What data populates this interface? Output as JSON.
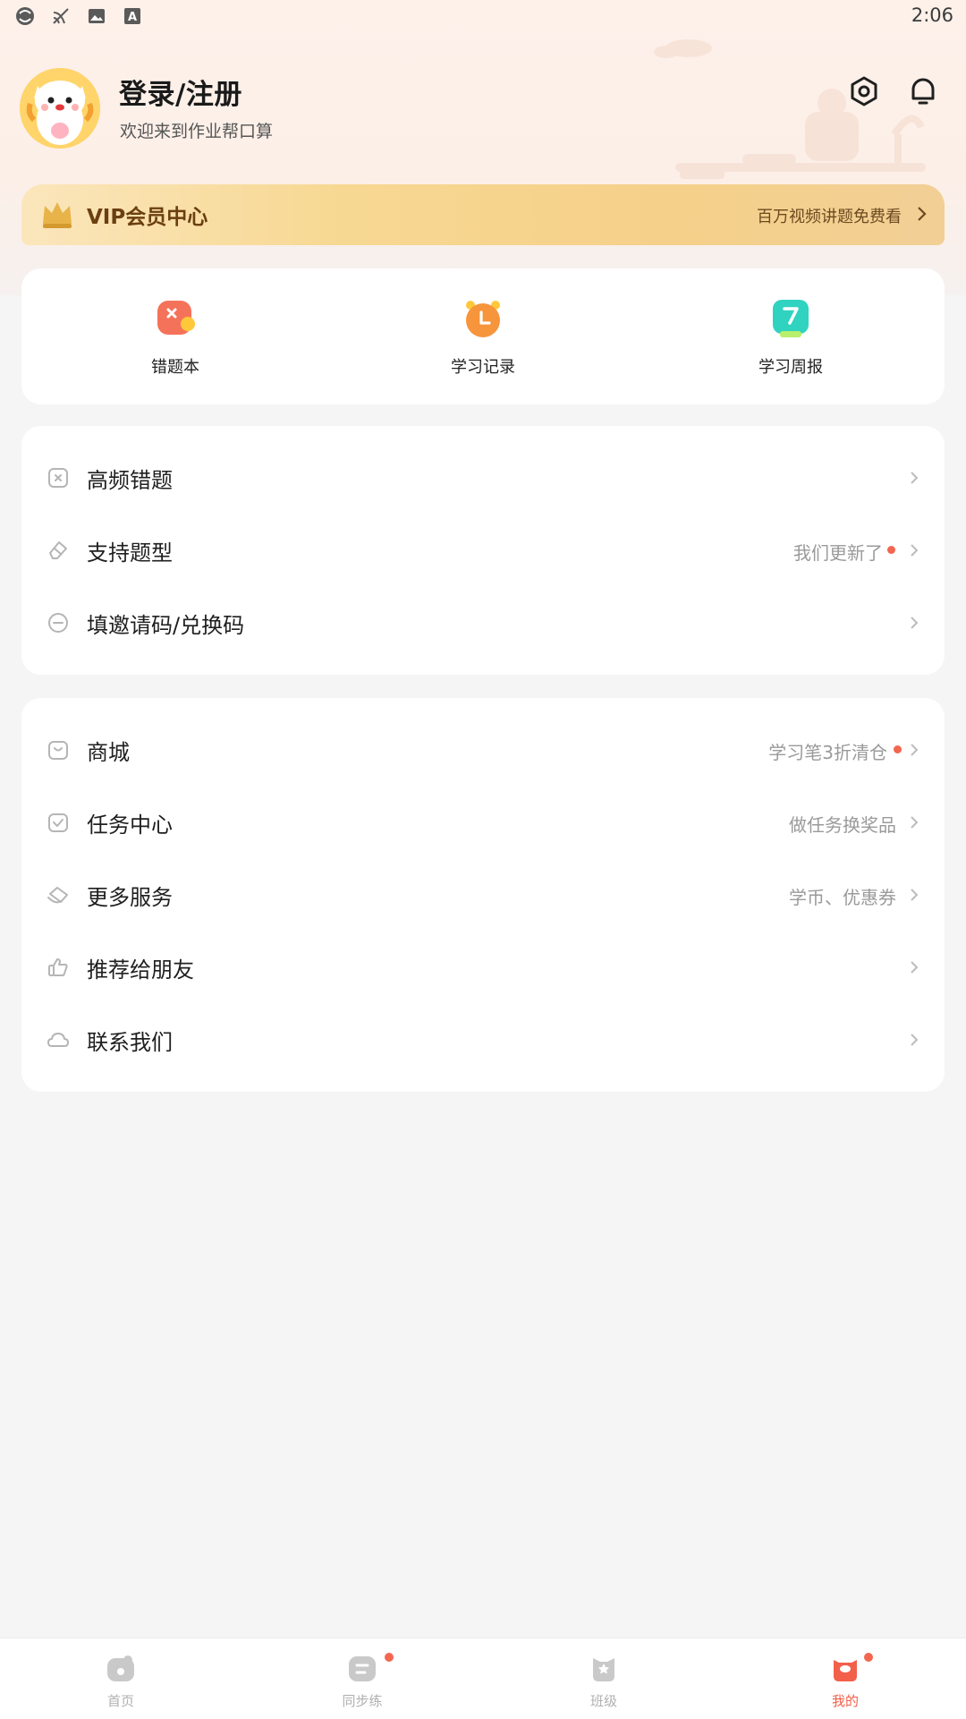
{
  "status_bar": {
    "time": "2:06",
    "icons": [
      "sync-icon",
      "cast-icon",
      "image-icon",
      "font-icon"
    ]
  },
  "profile": {
    "title": "登录/注册",
    "subtitle": "欢迎来到作业帮口算",
    "avatar": "cat-mascot-avatar"
  },
  "header_icons": [
    "settings-icon",
    "bell-icon"
  ],
  "vip": {
    "title": "VIP会员中心",
    "subtitle": "百万视频讲题免费看"
  },
  "quick_actions": [
    {
      "label": "错题本",
      "icon": "mistake-book-icon",
      "color": "#f5725a"
    },
    {
      "label": "学习记录",
      "icon": "clock-icon",
      "color": "#f6953b"
    },
    {
      "label": "学习周报",
      "icon": "weekly-report-icon",
      "color": "#2fd3c0"
    }
  ],
  "menu_group_1": [
    {
      "title": "高频错题",
      "hint": "",
      "dot": false,
      "icon": "error-square-icon"
    },
    {
      "title": "支持题型",
      "hint": "我们更新了",
      "dot": true,
      "icon": "eraser-icon"
    },
    {
      "title": "填邀请码/兑换码",
      "hint": "",
      "dot": false,
      "icon": "ticket-icon"
    }
  ],
  "menu_group_2": [
    {
      "title": "商城",
      "hint": "学习笔3折清仓",
      "dot": true,
      "icon": "shop-icon"
    },
    {
      "title": "任务中心",
      "hint": "做任务换奖品",
      "dot": false,
      "icon": "task-check-icon"
    },
    {
      "title": "更多服务",
      "hint": "学币、优惠券",
      "dot": false,
      "icon": "coupon-icon"
    },
    {
      "title": "推荐给朋友",
      "hint": "",
      "dot": false,
      "icon": "thumbs-up-icon"
    },
    {
      "title": "联系我们",
      "hint": "",
      "dot": false,
      "icon": "chat-cloud-icon"
    }
  ],
  "tabs": [
    {
      "label": "首页",
      "icon": "home-icon",
      "active": false,
      "dot": false
    },
    {
      "label": "同步练",
      "icon": "practice-icon",
      "active": false,
      "dot": true
    },
    {
      "label": "班级",
      "icon": "class-icon",
      "active": false,
      "dot": false
    },
    {
      "label": "我的",
      "icon": "mine-icon",
      "active": true,
      "dot": true
    }
  ],
  "colors": {
    "accent": "#f2604a",
    "vip_gold": "#f5d08a",
    "vip_text": "#6b3f10",
    "badge_red": "#f3664f"
  }
}
